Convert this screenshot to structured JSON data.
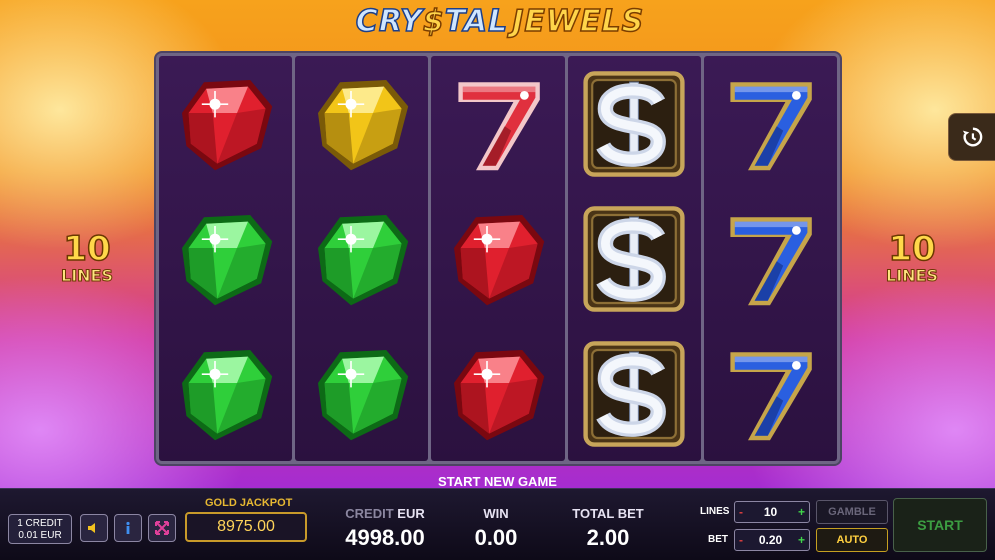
{
  "title": {
    "part1": "CRY",
    "part2": "$",
    "part3": "TAL",
    "part4": "JEWELS"
  },
  "lines_badge": {
    "number": "10",
    "word": "LINES"
  },
  "reels": [
    [
      "ruby",
      "emerald",
      "emerald"
    ],
    [
      "topaz",
      "emerald",
      "emerald"
    ],
    [
      "red-seven",
      "ruby",
      "ruby"
    ],
    [
      "dollar",
      "dollar",
      "dollar"
    ],
    [
      "blue-seven",
      "blue-seven",
      "blue-seven"
    ]
  ],
  "status_message": "START NEW GAME",
  "bottom_bar": {
    "credit_value": {
      "line1": "1 CREDIT",
      "line2": "0.01 EUR"
    },
    "icons": [
      "sound-icon",
      "info-icon",
      "fullscreen-icon"
    ],
    "gold_jackpot": {
      "label": "GOLD JACKPOT",
      "value": "8975.00"
    },
    "credit": {
      "label": "CREDIT",
      "currency": "EUR",
      "value": "4998.00"
    },
    "win": {
      "label": "WIN",
      "value": "0.00"
    },
    "total_bet": {
      "label": "TOTAL BET",
      "value": "2.00"
    },
    "lines": {
      "label": "LINES",
      "value": "10",
      "minus": "-",
      "plus": "+"
    },
    "bet": {
      "label": "BET",
      "value": "0.20",
      "minus": "-",
      "plus": "+"
    },
    "gamble_label": "GAMBLE",
    "auto_label": "AUTO",
    "start_label": "START"
  },
  "colors": {
    "ruby": "#e0202e",
    "emerald": "#2fcf3a",
    "topaz": "#f2c518",
    "blue_seven": "#2a4fd6",
    "gold": "#e7b832"
  }
}
